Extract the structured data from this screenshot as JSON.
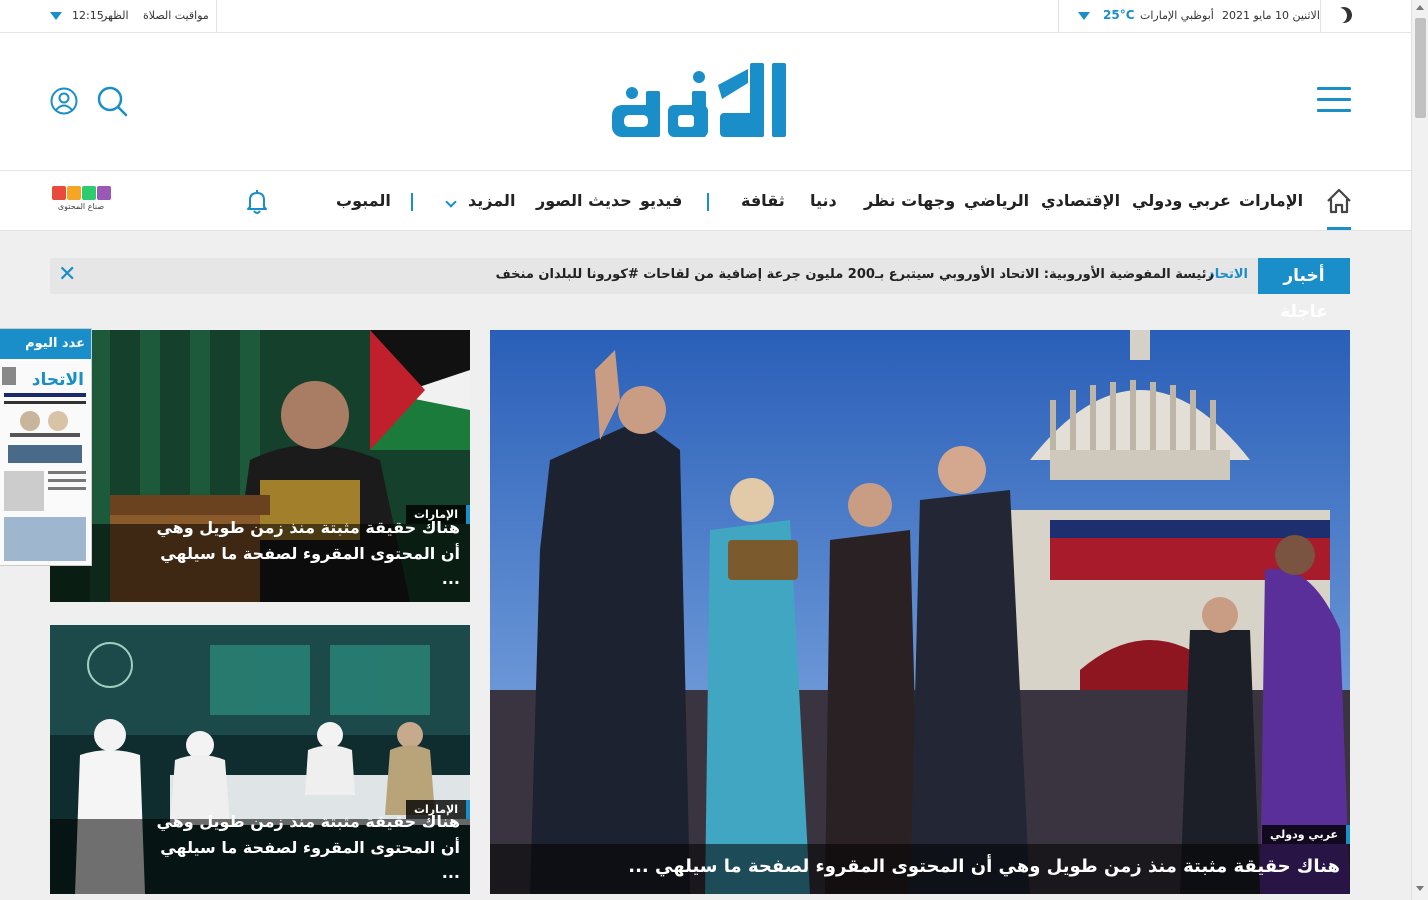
{
  "topbar": {
    "date": "الاثنين 10 مايو 2021",
    "location": "أبوظبي الإمارات",
    "temperature": "25°C",
    "prayer_label": "مواقيت الصلاة",
    "prayer_name": "الظهر",
    "prayer_time": "12:15"
  },
  "header": {
    "logo_text": "الاتحاد"
  },
  "nav": {
    "items": [
      {
        "label": "الإمارات"
      },
      {
        "label": "عربي ودولي"
      },
      {
        "label": "الإقتصادي"
      },
      {
        "label": "الرياضي"
      },
      {
        "label": "وجهات نظر"
      },
      {
        "label": "دنيا"
      },
      {
        "label": "ثقافة"
      },
      {
        "label": "فيديو"
      },
      {
        "label": "حديث الصور"
      },
      {
        "label": "المزيد"
      },
      {
        "label": "المبوب"
      }
    ],
    "content_creators_label": "صناع المحتوى"
  },
  "breaking": {
    "badge": "أخبار عاجلة",
    "brand": "الاتحاد",
    "text": "رئيسة المفوضية الأوروبية: الاتحاد الأوروبي سيتبرع بـ200 مليون جرعة إضافية من لقاحات #كورونا للبلدان منخف"
  },
  "stories": {
    "main": {
      "category": "عربي ودولي",
      "headline": "هناك حقيقة مثبتة منذ زمن طويل وهي أن المحتوى المقروء لصفحة ما سيلهي ..."
    },
    "side_top": {
      "category": "الإمارات",
      "headline": "هناك حقيقة مثبتة منذ زمن طويل وهي أن المحتوى المقروء لصفحة ما سيلهي ..."
    },
    "side_bottom": {
      "category": "الإمارات",
      "headline": "هناك حقيقة مثبتة منذ زمن طويل وهي أن المحتوى المقروء لصفحة ما سيلهي ..."
    }
  },
  "edition": {
    "label": "عدد اليوم",
    "masthead": "الاتحاد"
  },
  "colors": {
    "accent": "#1a8ec9"
  }
}
